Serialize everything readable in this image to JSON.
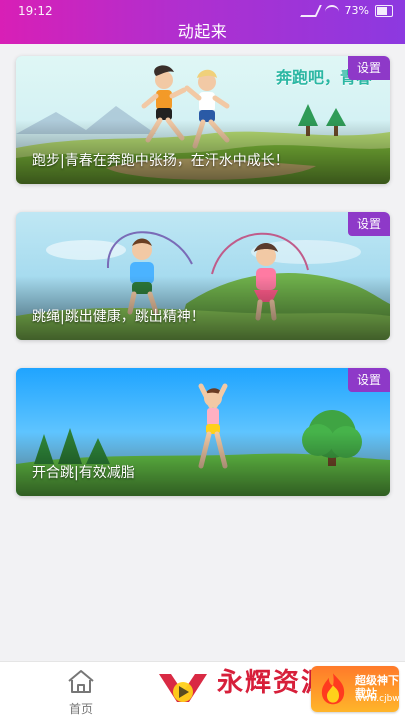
{
  "status_bar": {
    "time": "19:12",
    "battery": "73%"
  },
  "header": {
    "title": "动起来"
  },
  "cards": [
    {
      "slogan": "奔跑吧，青春",
      "caption": "跑步|青春在奔跑中张扬，在汗水中成长！",
      "settings_label": "设置"
    },
    {
      "slogan": "",
      "caption": "跳绳|跳出健康，跳出精神！",
      "settings_label": "设置"
    },
    {
      "slogan": "",
      "caption": "开合跳|有效减脂",
      "settings_label": "设置"
    }
  ],
  "bottom_nav": {
    "home_label": "首页"
  },
  "watermark": {
    "brand": "永辉资源网",
    "site": "超级神下载站",
    "site_url": "www.cjbwl.com"
  },
  "colors": {
    "header_start": "#d81fb6",
    "header_end": "#8c39e0",
    "settings_bg": "#8e39c8",
    "slogan": "#2bb7a3"
  }
}
